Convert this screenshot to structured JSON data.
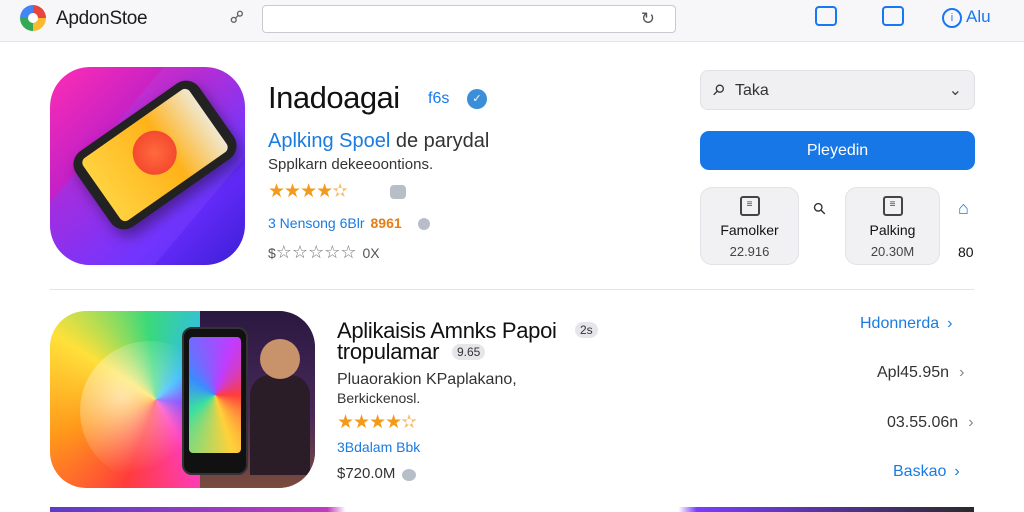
{
  "topbar": {
    "app_name": "ApdonStoe",
    "icons": [
      "logo-icon",
      "link-icon",
      "reload-icon",
      "calendar-icon",
      "window-icon",
      "user-icon"
    ],
    "user_label": "Alu"
  },
  "hero": {
    "title": "Inadoagai",
    "title_badge": "f6s",
    "developer_blue": "Aplking Spoel",
    "developer_rest": "de parydal",
    "subtitle": "Spplkarn dekeeoontions.",
    "rating_stars": 4.5,
    "meta_prefix": "3 Nensong 6Blr",
    "meta_number": "8961",
    "outline_rating_prefix": "$",
    "outline_rating_suffix": "0X"
  },
  "panel": {
    "search_label": "Taka",
    "primary_button": "Pleyedin",
    "card_a": {
      "title": "Famolker",
      "value": "22.916"
    },
    "card_b": {
      "title": "Palking",
      "value": "20.30M"
    },
    "side_number": "80"
  },
  "listing": {
    "title_line1": "Aplikaisis Amnks Papoi",
    "title_badge": "2s",
    "title_line2": "tropulamar",
    "title_line2_badge": "9.65",
    "desc_line1": "Pluaorakion KPaplakano,",
    "desc_line2": "Berkickenosl.",
    "rating_stars": 4.5,
    "meta": "3Bdalam Bbk",
    "price": "$720.0M"
  },
  "right_list": {
    "link1": "Hdonnerda",
    "row2": "Apl45.95n",
    "row4": "03.55.06n",
    "link3": "Baskao"
  },
  "colors": {
    "accent": "#1877e6",
    "star": "#f29a1c",
    "link": "#1a7be0"
  }
}
